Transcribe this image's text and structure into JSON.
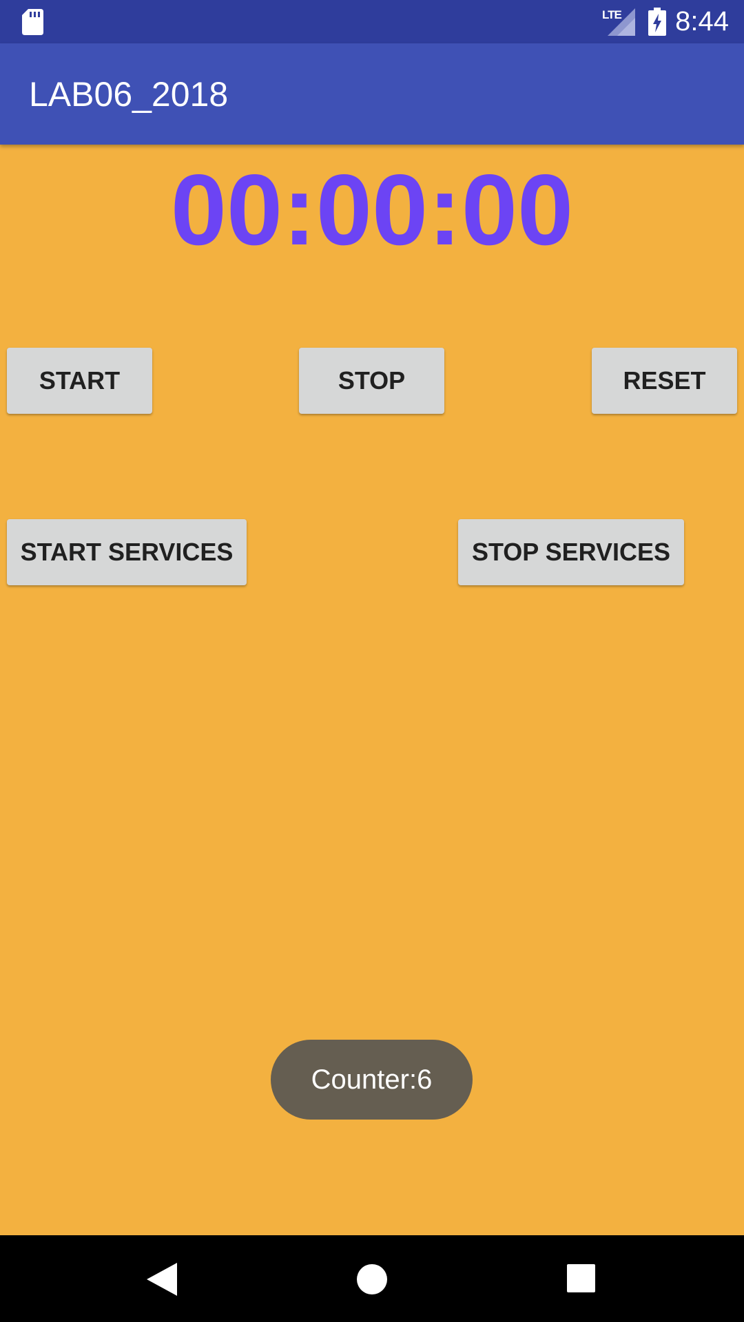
{
  "status_bar": {
    "network_label": "LTE",
    "time": "8:44",
    "icons": [
      "sd-card-icon",
      "signal-icon",
      "battery-charging-icon"
    ],
    "background_color": "#2f3d9c"
  },
  "app_bar": {
    "title": "LAB06_2018",
    "background_color": "#3f51b5"
  },
  "timer": {
    "value": "00:00:00",
    "color": "#6c44f4"
  },
  "buttons": {
    "start": "START",
    "stop": "STOP",
    "reset": "RESET",
    "start_services": "START SERVICES",
    "stop_services": "STOP SERVICES"
  },
  "toast": {
    "message": "Counter:6"
  },
  "nav_bar": {
    "icons": [
      "back-icon",
      "home-icon",
      "recents-icon"
    ]
  },
  "colors": {
    "background": "#f3b140",
    "button": "#d6d7d7",
    "toast": "#655e51"
  }
}
